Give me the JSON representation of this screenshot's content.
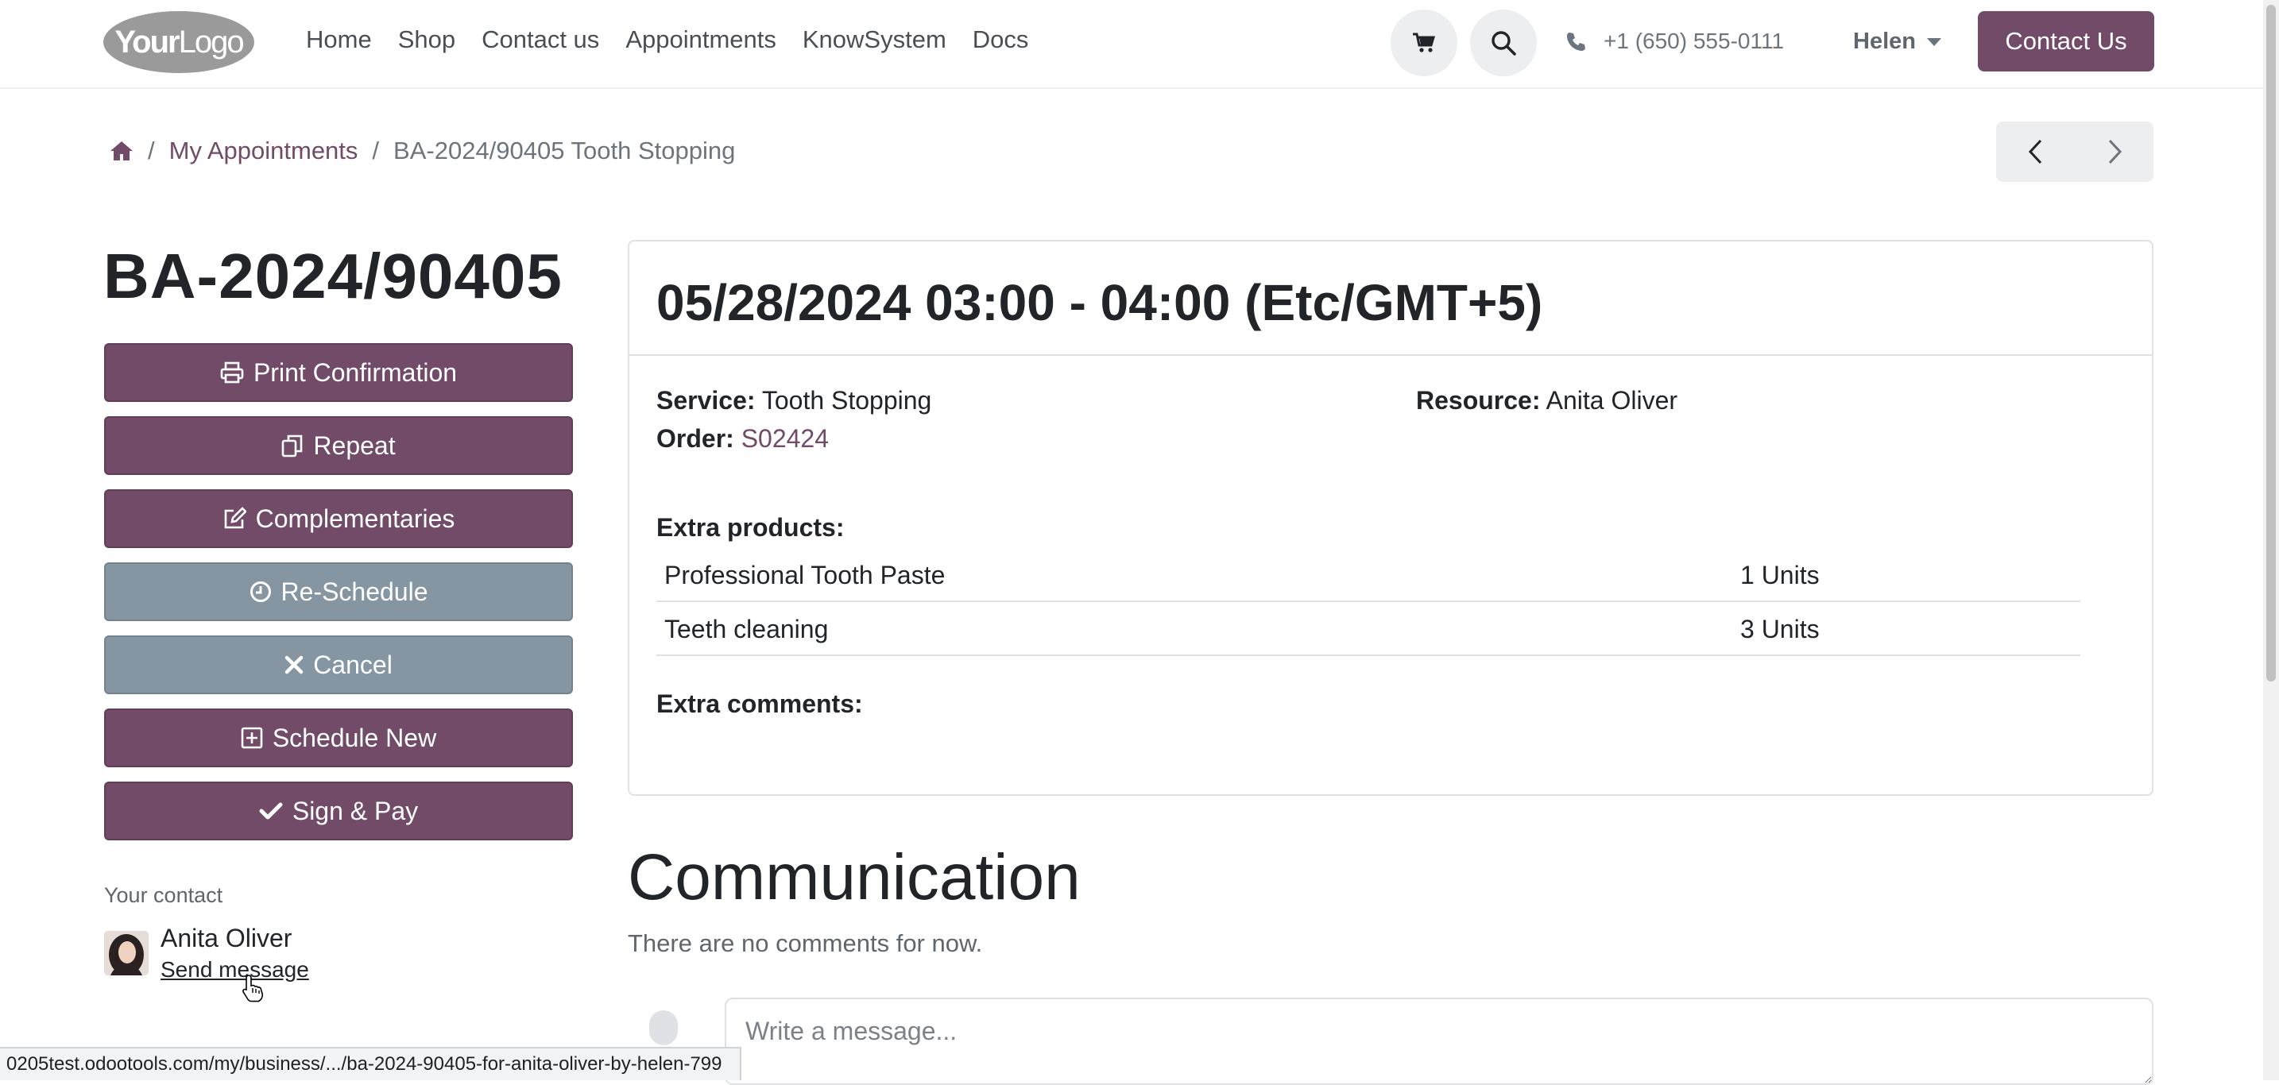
{
  "header": {
    "logo_text_bold": "Your",
    "logo_text_light": "Logo",
    "nav": [
      "Home",
      "Shop",
      "Contact us",
      "Appointments",
      "KnowSystem",
      "Docs"
    ],
    "phone": "+1 (650) 555-0111",
    "user": "Helen",
    "contact_button": "Contact Us"
  },
  "breadcrumb": {
    "parent": "My Appointments",
    "current": "BA-2024/90405 Tooth Stopping",
    "separator": "/"
  },
  "sidebar": {
    "title": "BA-2024/90405",
    "buttons": {
      "print": "Print Confirmation",
      "repeat": "Repeat",
      "complementaries": "Complementaries",
      "reschedule": "Re-Schedule",
      "cancel": "Cancel",
      "schedule_new": "Schedule New",
      "sign_pay": "Sign & Pay"
    },
    "contact_label": "Your contact",
    "contact_name": "Anita Oliver",
    "send_message": "Send message"
  },
  "appointment": {
    "datetime": "05/28/2024 03:00 - 04:00 (Etc/GMT+5)",
    "service_label": "Service:",
    "service": "Tooth Stopping",
    "resource_label": "Resource:",
    "resource": "Anita Oliver",
    "order_label": "Order:",
    "order": "S02424",
    "extra_products_label": "Extra products:",
    "extra_products": [
      {
        "name": "Professional Tooth Paste",
        "qty": "1 Units"
      },
      {
        "name": "Teeth cleaning",
        "qty": "3 Units"
      }
    ],
    "extra_comments_label": "Extra comments:"
  },
  "communication": {
    "title": "Communication",
    "empty_text": "There are no comments for now.",
    "placeholder": "Write a message..."
  },
  "statusbar": {
    "url": "0205test.odootools.com/my/business/.../ba-2024-90405-for-anita-oliver-by-helen-799"
  },
  "colors": {
    "primary": "#714b67",
    "secondary": "#8595a2"
  }
}
